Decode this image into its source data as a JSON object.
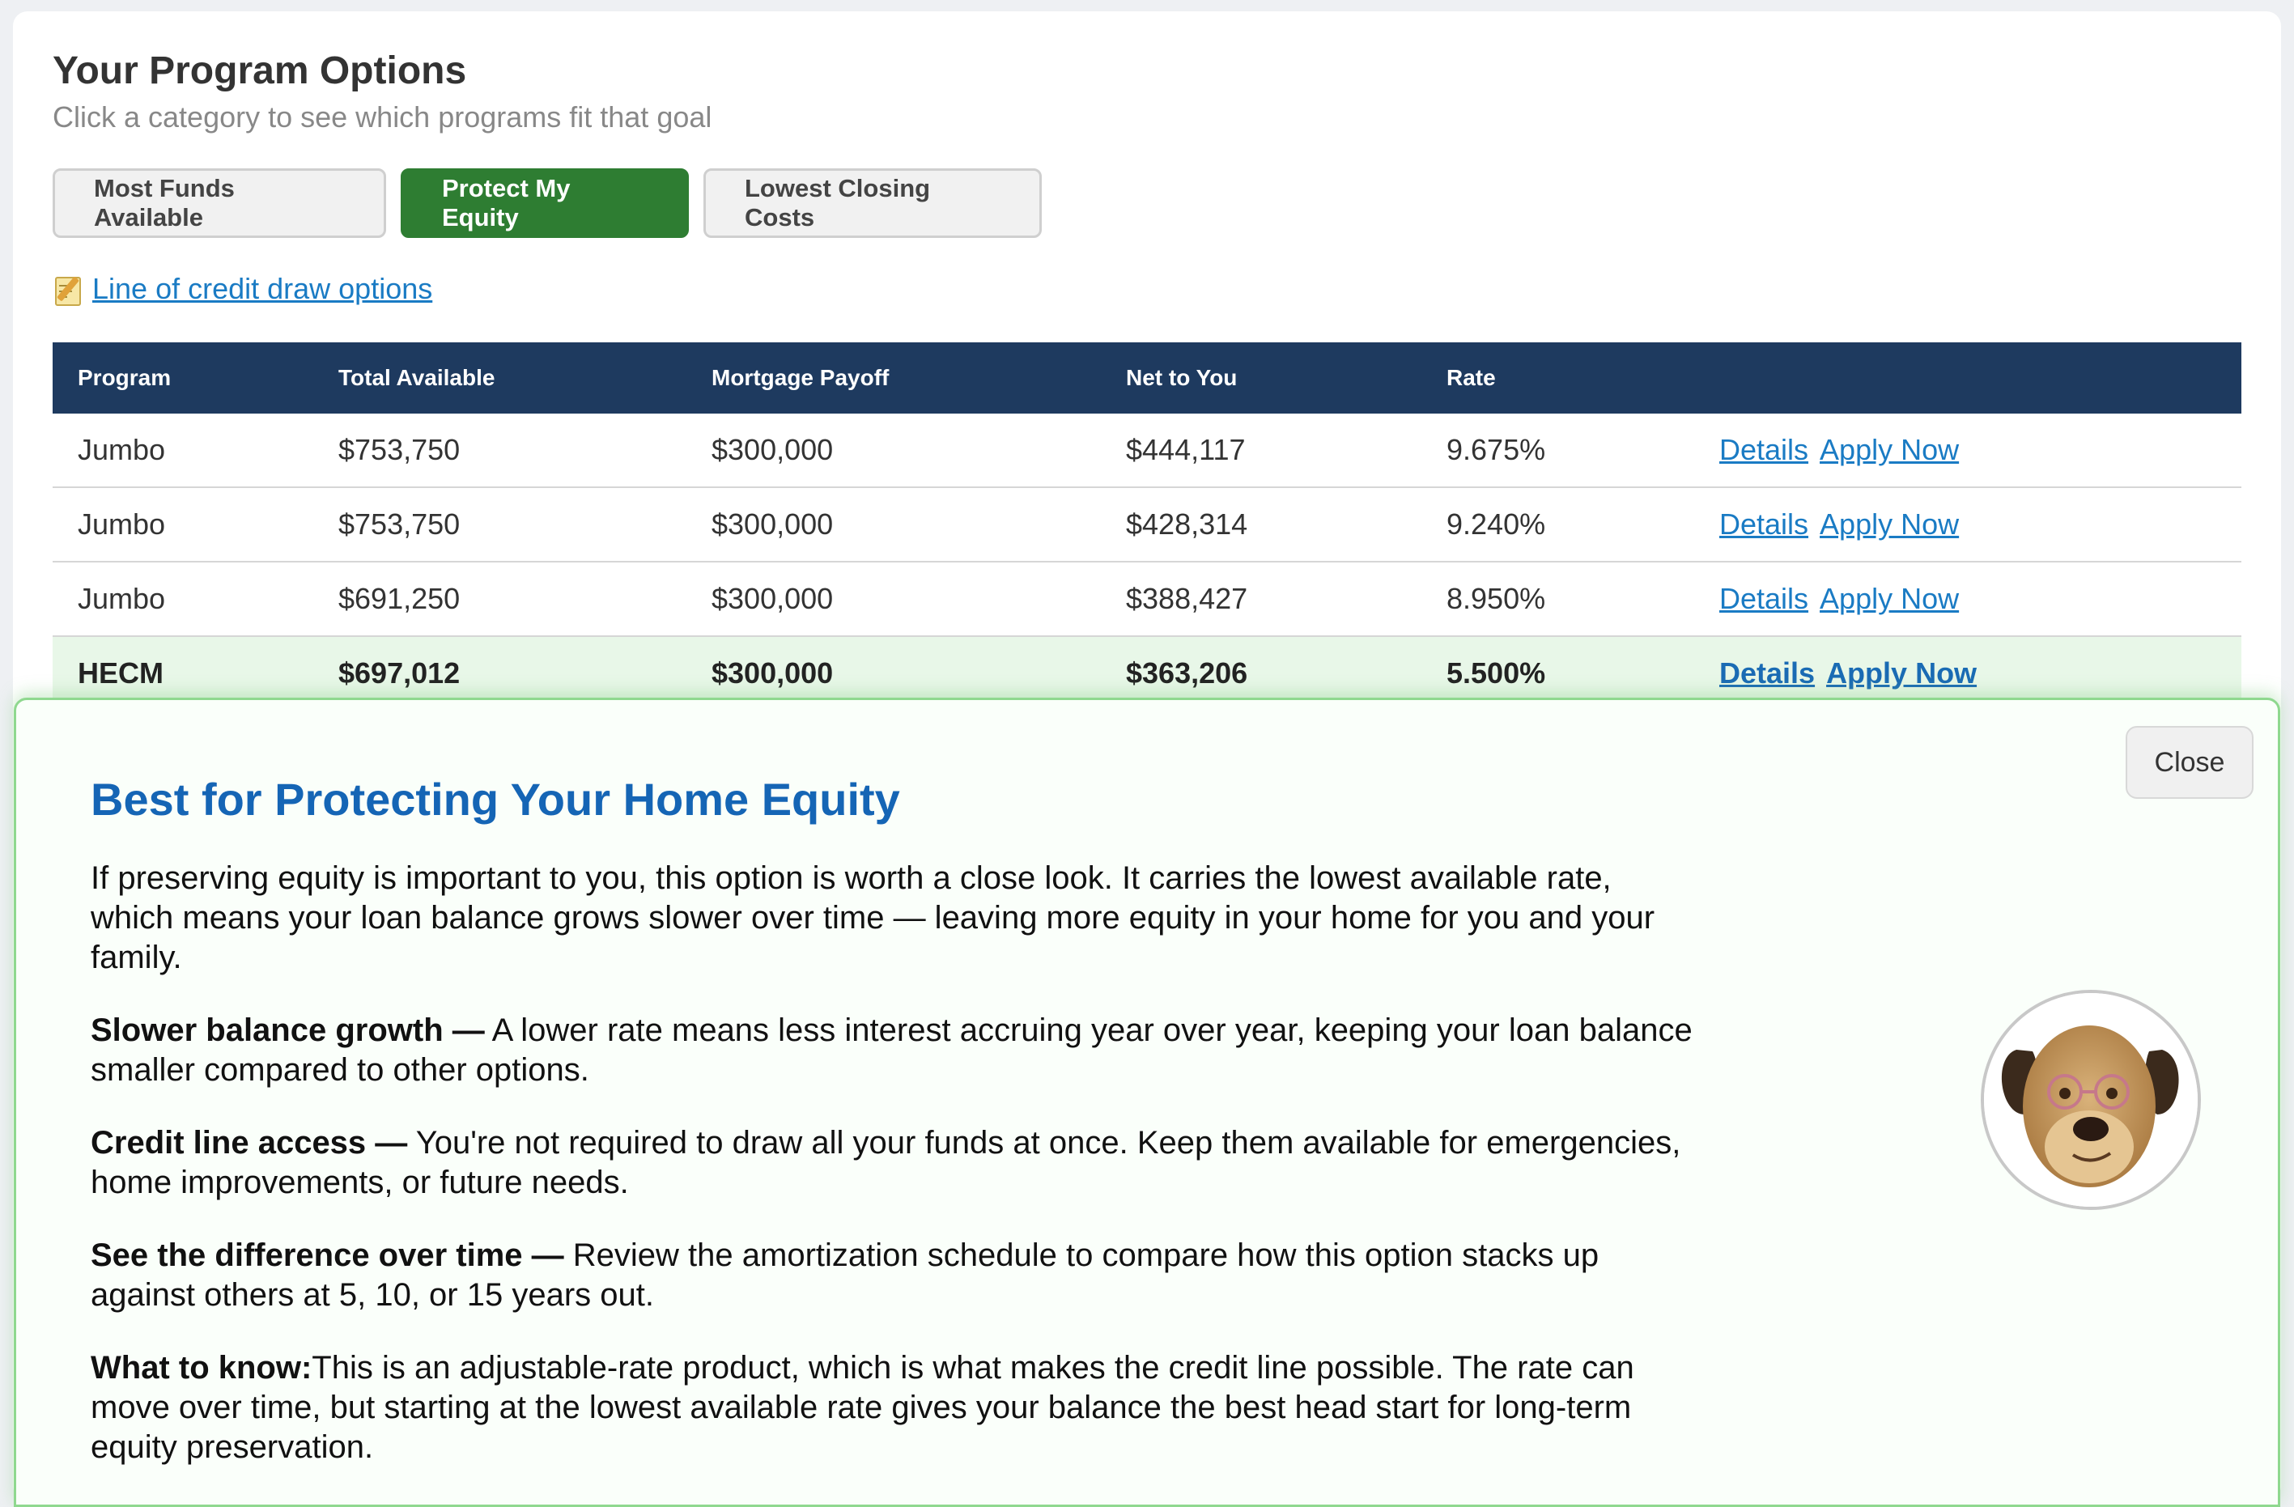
{
  "header": {
    "title": "Your Program Options",
    "subtitle": "Click a category to see which programs fit that goal"
  },
  "tabs": [
    {
      "label": "Most Funds Available",
      "active": false
    },
    {
      "label": "Protect My Equity",
      "active": true
    },
    {
      "label": "Lowest Closing Costs",
      "active": false
    }
  ],
  "credit_link": {
    "icon": "memo-icon",
    "label": "Line of credit draw options"
  },
  "table": {
    "columns": [
      "Program",
      "Total Available",
      "Mortgage Payoff",
      "Net to You",
      "Rate",
      ""
    ],
    "rows": [
      {
        "program": "Jumbo",
        "total": "$753,750",
        "payoff": "$300,000",
        "net": "$444,117",
        "rate": "9.675%",
        "details": "Details",
        "apply": "Apply Now"
      },
      {
        "program": "Jumbo",
        "total": "$753,750",
        "payoff": "$300,000",
        "net": "$428,314",
        "rate": "9.240%",
        "details": "Details",
        "apply": "Apply Now"
      },
      {
        "program": "Jumbo",
        "total": "$691,250",
        "payoff": "$300,000",
        "net": "$388,427",
        "rate": "8.950%",
        "details": "Details",
        "apply": "Apply Now"
      },
      {
        "program": "HECM",
        "total": "$697,012",
        "payoff": "$300,000",
        "net": "$363,206",
        "rate": "5.500%",
        "details": "Details",
        "apply": "Apply Now",
        "highlighted": true
      }
    ]
  },
  "modal": {
    "close_label": "Close",
    "title": "Best for Protecting Your Home Equity",
    "intro": "If preserving equity is important to you, this option is worth a close look. It carries the lowest available rate, which means your loan balance grows slower over time — leaving more equity in your home for you and your family.",
    "points": [
      {
        "lead": "Slower balance growth —",
        "text": " A lower rate means less interest accruing year over year, keeping your loan balance smaller compared to other options."
      },
      {
        "lead": "Credit line access —",
        "text": " You're not required to draw all your funds at once. Keep them available for emergencies, home improvements, or future needs."
      },
      {
        "lead": "See the difference over time —",
        "text": " Review the amortization schedule to compare how this option stacks up against others at 5, 10, or 15 years out."
      },
      {
        "lead": "What to know:",
        "text": "This is an adjustable-rate product, which is what makes the credit line possible. The rate can move over time, but starting at the lowest available rate gives your balance the best head start for long-term equity preservation."
      }
    ],
    "mascot": "dog-mascot-avatar"
  },
  "colors": {
    "accent_green": "#2e7d32",
    "header_navy": "#1e3a5f",
    "link_blue": "#1a7bc4",
    "modal_title_blue": "#1565b5",
    "highlight_row": "#e8f7e8"
  }
}
